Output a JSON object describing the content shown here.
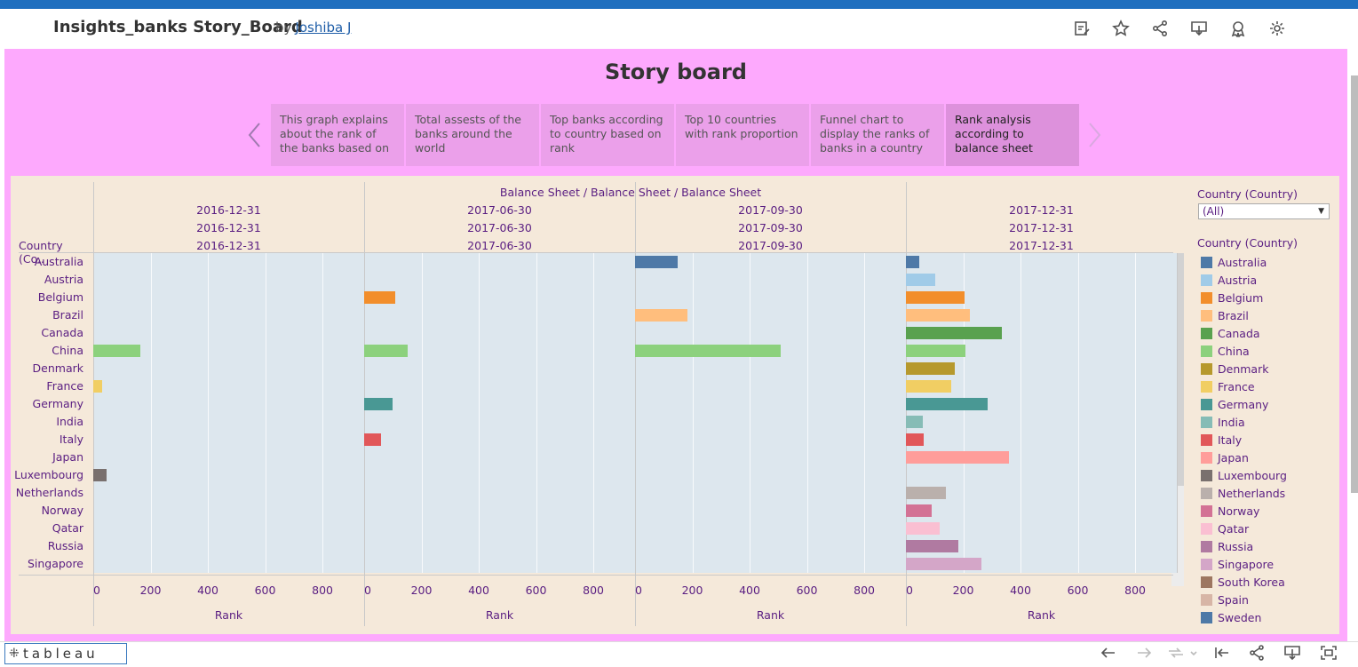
{
  "header": {
    "title": "Insights_banks Story_Board",
    "by": "by",
    "author": "Joshiba J",
    "icons": [
      "edit-metadata-icon",
      "favorite-star-icon",
      "share-icon",
      "download-icon",
      "badge-icon",
      "settings-gear-icon"
    ]
  },
  "story": {
    "title": "Story board",
    "points": [
      "This graph explains about the rank of the banks based on",
      "Total assests of the banks around the world",
      "Top banks according to country based on rank",
      "Top 10 countries with rank proportion",
      "Funnel chart to display the ranks of banks in a country",
      "Rank analysis according to balance sheet"
    ],
    "active_point": 5
  },
  "sheet": {
    "top_header": "Balance Sheet / Balance Sheet / Balance Sheet",
    "row_header": "Country (Co..",
    "column_dates": [
      "2016-12-31",
      "2017-06-30",
      "2017-09-30",
      "2017-12-31"
    ],
    "axis_ticks": [
      "0",
      "200",
      "400",
      "600",
      "800"
    ],
    "axis_label": "Rank"
  },
  "filter": {
    "title": "Country (Country)",
    "selected": "(All)"
  },
  "legend": {
    "title": "Country (Country)",
    "items": [
      {
        "name": "Australia",
        "color": "#4e79a7"
      },
      {
        "name": "Austria",
        "color": "#a0cbe8"
      },
      {
        "name": "Belgium",
        "color": "#f28e2b"
      },
      {
        "name": "Brazil",
        "color": "#ffbe7d"
      },
      {
        "name": "Canada",
        "color": "#59a14f"
      },
      {
        "name": "China",
        "color": "#8cd17d"
      },
      {
        "name": "Denmark",
        "color": "#b6992d"
      },
      {
        "name": "France",
        "color": "#f1ce63"
      },
      {
        "name": "Germany",
        "color": "#499894"
      },
      {
        "name": "India",
        "color": "#86bcb6"
      },
      {
        "name": "Italy",
        "color": "#e15759"
      },
      {
        "name": "Japan",
        "color": "#ff9d9a"
      },
      {
        "name": "Luxembourg",
        "color": "#79706e"
      },
      {
        "name": "Netherlands",
        "color": "#bab0ac"
      },
      {
        "name": "Norway",
        "color": "#d37295"
      },
      {
        "name": "Qatar",
        "color": "#fabfd2"
      },
      {
        "name": "Russia",
        "color": "#b07aa1"
      },
      {
        "name": "Singapore",
        "color": "#d4a6c8"
      },
      {
        "name": "South Korea",
        "color": "#9d7660"
      },
      {
        "name": "Spain",
        "color": "#d7b5a6"
      },
      {
        "name": "Sweden",
        "color": "#4e79a7"
      }
    ]
  },
  "chart_data": {
    "type": "bar",
    "orientation": "horizontal",
    "categories": [
      "Australia",
      "Austria",
      "Belgium",
      "Brazil",
      "Canada",
      "China",
      "Denmark",
      "France",
      "Germany",
      "India",
      "Italy",
      "Japan",
      "Luxembourg",
      "Netherlands",
      "Norway",
      "Qatar",
      "Russia",
      "Singapore"
    ],
    "xlabel": "Rank",
    "xlim": [
      0,
      930
    ],
    "x_ticks": [
      0,
      200,
      400,
      600,
      800
    ],
    "panels": [
      {
        "date": "2016-12-31",
        "values": {
          "China": 163,
          "France": 30,
          "Luxembourg": 48
        }
      },
      {
        "date": "2017-06-30",
        "values": {
          "Belgium": 107,
          "China": 153,
          "Germany": 100,
          "Italy": 58
        }
      },
      {
        "date": "2017-09-30",
        "values": {
          "Australia": 150,
          "Brazil": 182,
          "China": 508
        }
      },
      {
        "date": "2017-12-31",
        "values": {
          "Australia": 45,
          "Austria": 103,
          "Belgium": 205,
          "Brazil": 224,
          "Canada": 335,
          "China": 208,
          "Denmark": 170,
          "France": 157,
          "Germany": 285,
          "India": 60,
          "Italy": 63,
          "Japan": 360,
          "Netherlands": 140,
          "Norway": 90,
          "Qatar": 118,
          "Russia": 183,
          "Singapore": 262
        }
      }
    ]
  },
  "toolbar": {
    "logo": "tableau",
    "buttons": [
      "undo-icon",
      "redo-icon",
      "revert-icon",
      "revert-all-icon",
      "share-icon",
      "download-icon",
      "fullscreen-icon"
    ]
  }
}
